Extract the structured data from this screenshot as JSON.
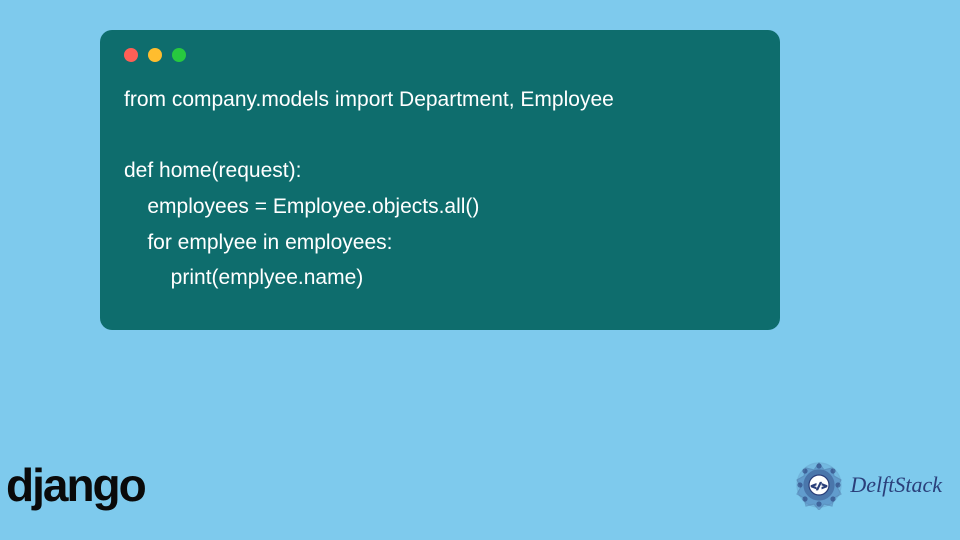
{
  "code": {
    "line1": "from company.models import Department, Employee",
    "line2": "",
    "line3": "def home(request):",
    "line4": "    employees = Employee.objects.all()",
    "line5": "    for emplyee in employees:",
    "line6": "        print(emplyee.name)"
  },
  "logos": {
    "django": "django",
    "delftstack": "DelftStack"
  },
  "colors": {
    "background": "#7ecaed",
    "codeBackground": "#0e6d6d",
    "codeText": "#ffffff",
    "djangoText": "#0a0a0a",
    "delftstackBlue": "#2a3f7a"
  }
}
